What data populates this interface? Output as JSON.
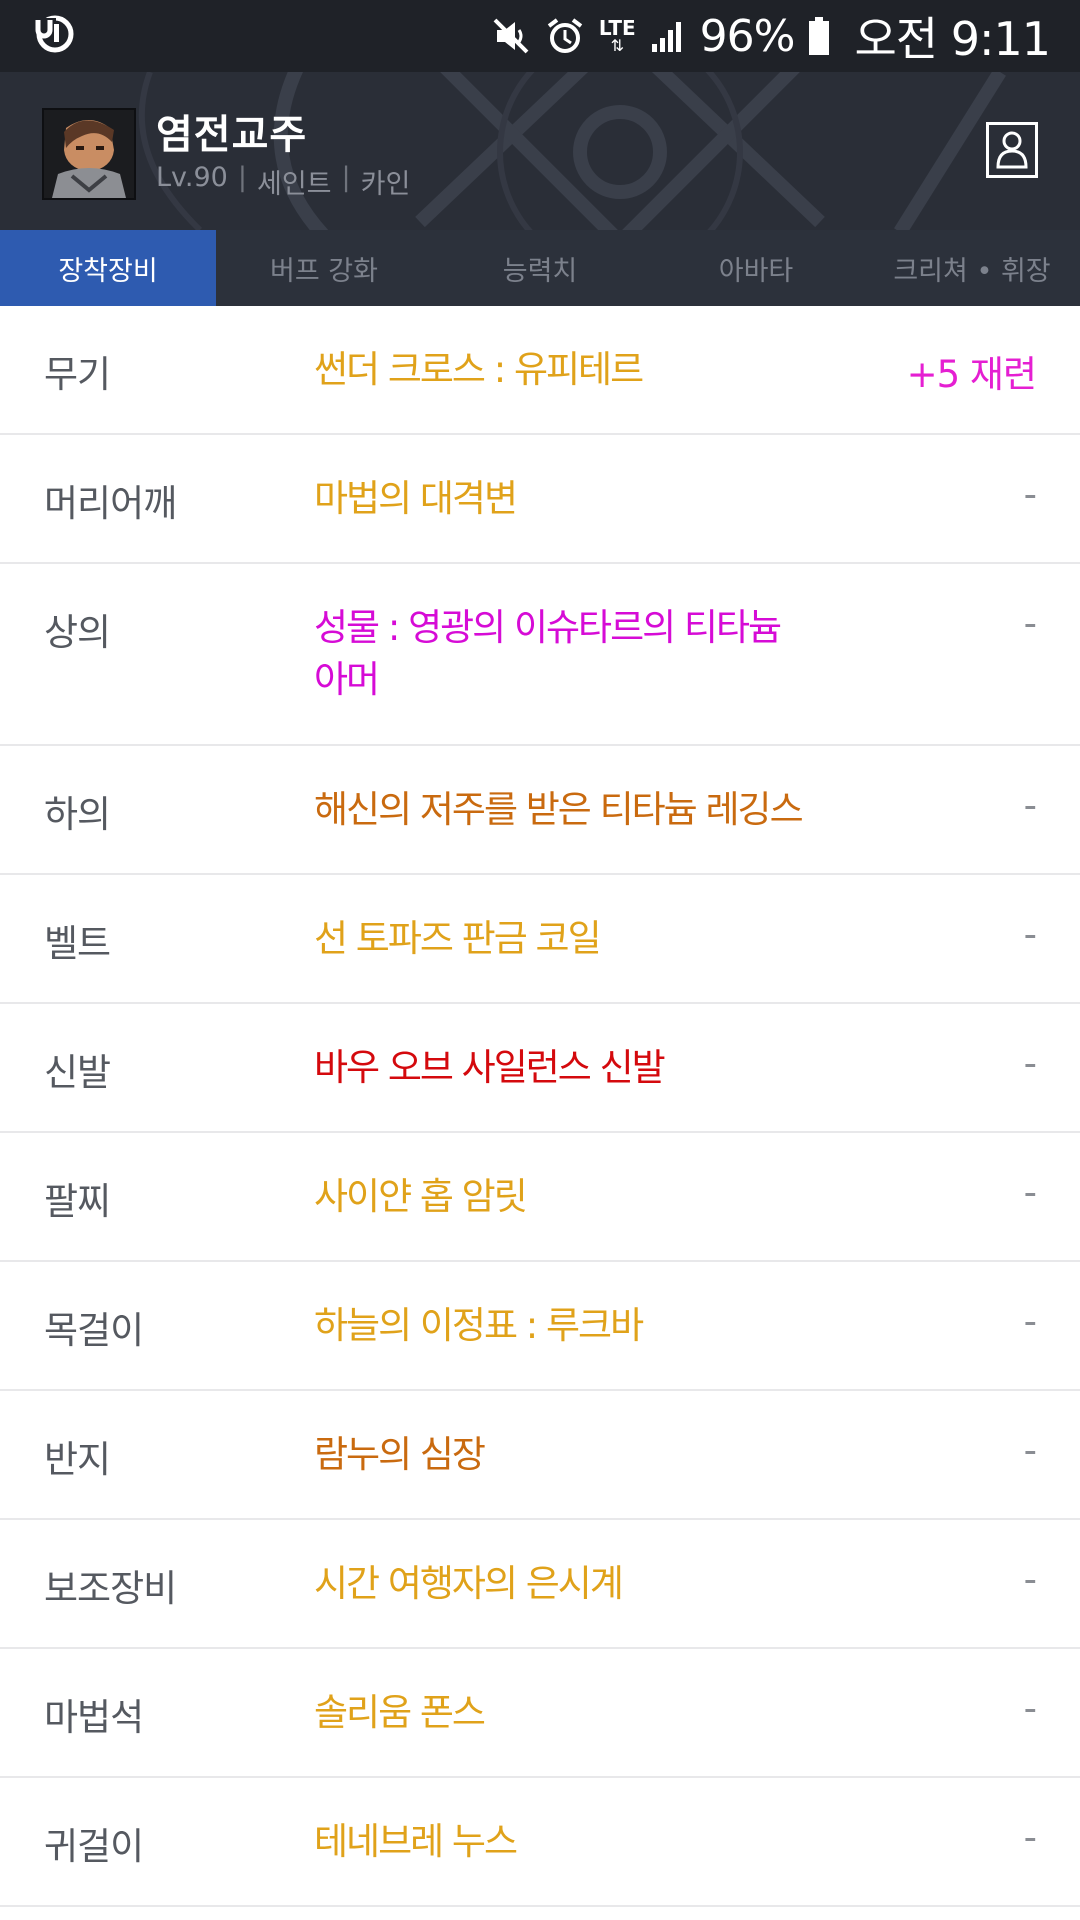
{
  "status_bar": {
    "battery": "96%",
    "time": "오전 9:11",
    "network": "LTE",
    "icons": [
      "app-logo-icon",
      "mute-icon",
      "alarm-icon",
      "lte-icon",
      "signal-icon",
      "battery-icon"
    ]
  },
  "header": {
    "character_name": "염전교주",
    "level": "Lv.90",
    "job": "세인트",
    "server": "카인",
    "separator": "|"
  },
  "tabs": [
    {
      "label": "장착장비",
      "active": true
    },
    {
      "label": "버프 강화",
      "active": false
    },
    {
      "label": "능력치",
      "active": false
    },
    {
      "label": "아바타",
      "active": false
    },
    {
      "label": "크리쳐 • 휘장",
      "active": false
    }
  ],
  "colors": {
    "epic": "#e0a21a",
    "legendary": "#c96a0f",
    "mythic": "#d60bd6",
    "unique": "#d4090d",
    "upgrade": "#e51fd2",
    "active_tab": "#2e5bb0"
  },
  "equipment": [
    {
      "slot": "무기",
      "item": "썬더 크로스 : 유피테르",
      "color": "#e0a21a",
      "extra": "+5 재련"
    },
    {
      "slot": "머리어깨",
      "item": "마법의 대격변",
      "color": "#e0a21a",
      "extra": "-"
    },
    {
      "slot": "상의",
      "item": "성물 : 영광의 이슈타르의 티타늄 아머",
      "color": "#d60bd6",
      "extra": "-"
    },
    {
      "slot": "하의",
      "item": "해신의 저주를 받은 티타늄 레깅스",
      "color": "#c96a0f",
      "extra": "-"
    },
    {
      "slot": "벨트",
      "item": "선 토파즈 판금 코일",
      "color": "#e0a21a",
      "extra": "-"
    },
    {
      "slot": "신발",
      "item": "바우 오브 사일런스 신발",
      "color": "#d4090d",
      "extra": "-"
    },
    {
      "slot": "팔찌",
      "item": "사이얀 홉 암릿",
      "color": "#e0a21a",
      "extra": "-"
    },
    {
      "slot": "목걸이",
      "item": "하늘의 이정표 : 루크바",
      "color": "#e0a21a",
      "extra": "-"
    },
    {
      "slot": "반지",
      "item": "람누의 심장",
      "color": "#c96a0f",
      "extra": "-"
    },
    {
      "slot": "보조장비",
      "item": "시간 여행자의 은시계",
      "color": "#e0a21a",
      "extra": "-"
    },
    {
      "slot": "마법석",
      "item": "솔리움 폰스",
      "color": "#e0a21a",
      "extra": "-"
    },
    {
      "slot": "귀걸이",
      "item": "테네브레 누스",
      "color": "#e0a21a",
      "extra": "-"
    }
  ]
}
